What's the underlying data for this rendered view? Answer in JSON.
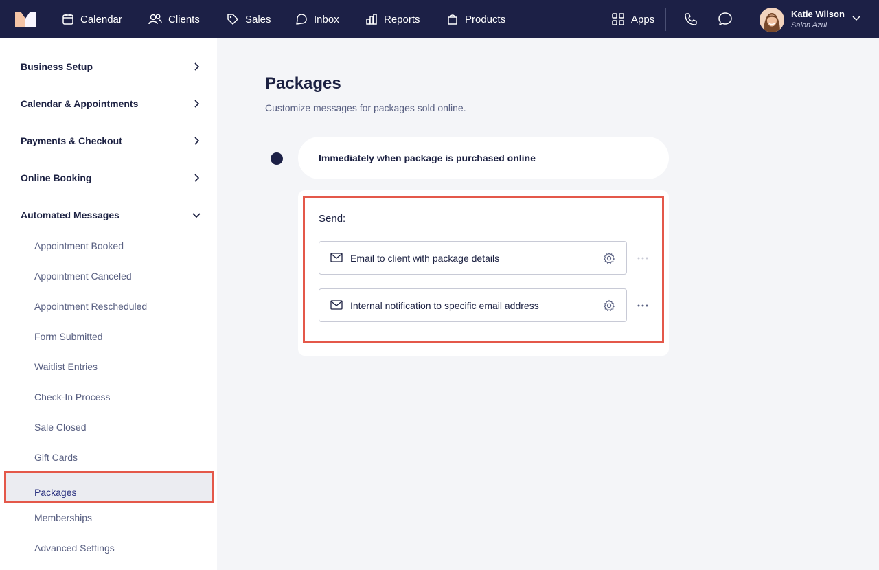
{
  "nav": {
    "items": [
      {
        "label": "Calendar",
        "icon": "calendar-icon"
      },
      {
        "label": "Clients",
        "icon": "clients-icon"
      },
      {
        "label": "Sales",
        "icon": "tag-icon"
      },
      {
        "label": "Inbox",
        "icon": "inbox-icon"
      },
      {
        "label": "Reports",
        "icon": "reports-icon"
      },
      {
        "label": "Products",
        "icon": "bag-icon"
      }
    ],
    "apps_label": "Apps",
    "user": {
      "name": "Katie Wilson",
      "business": "Salon Azul"
    }
  },
  "sidebar": {
    "sections": [
      {
        "label": "Business Setup",
        "expanded": false
      },
      {
        "label": "Calendar & Appointments",
        "expanded": false
      },
      {
        "label": "Payments & Checkout",
        "expanded": false
      },
      {
        "label": "Online Booking",
        "expanded": false
      },
      {
        "label": "Automated Messages",
        "expanded": true
      }
    ],
    "sub_items": [
      "Appointment Booked",
      "Appointment Canceled",
      "Appointment Rescheduled",
      "Form Submitted",
      "Waitlist Entries",
      "Check-In Process",
      "Sale Closed",
      "Gift Cards",
      "Packages",
      "Memberships",
      "Advanced Settings"
    ],
    "active_item": "Packages"
  },
  "main": {
    "title": "Packages",
    "subtitle": "Customize messages for packages sold online.",
    "trigger": "Immediately when package is purchased online",
    "send_label": "Send:",
    "messages": [
      {
        "label": "Email to client with package details",
        "icon": "mail-icon"
      },
      {
        "label": "Internal notification to specific email address",
        "icon": "mail-icon"
      }
    ]
  },
  "colors": {
    "nav_bg": "#1c2046",
    "highlight": "#e4584a",
    "page_bg": "#f4f5f8"
  }
}
